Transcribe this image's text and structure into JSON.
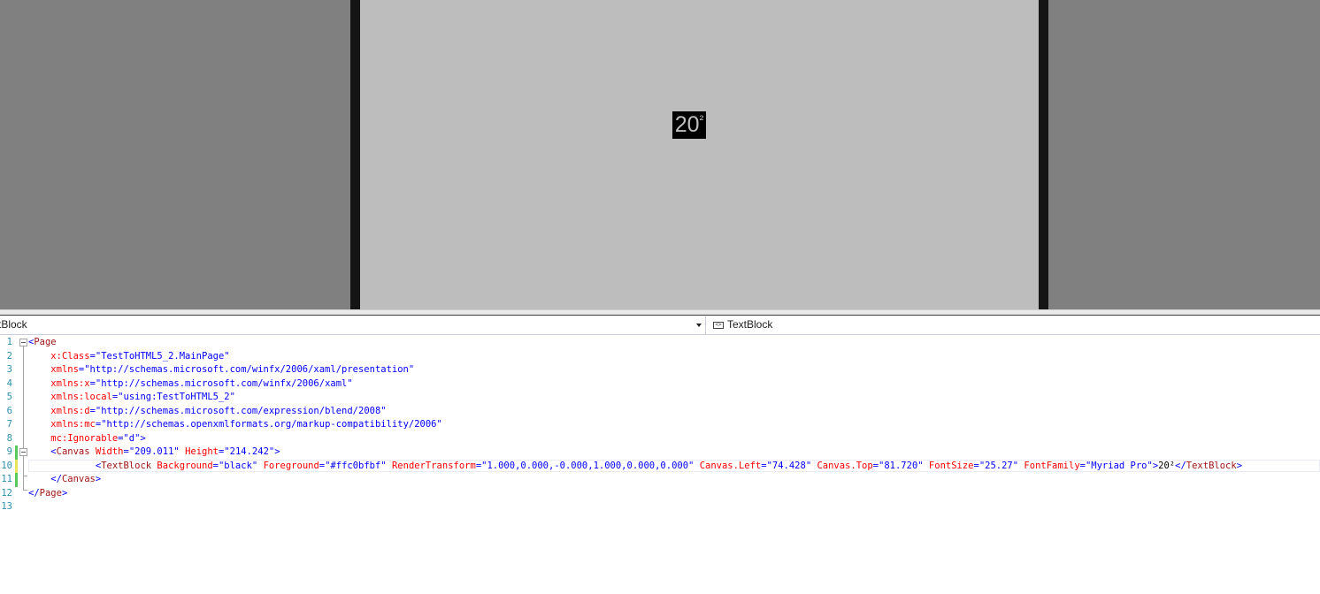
{
  "designer": {
    "textblock": {
      "base": "20",
      "superscript": "²",
      "background_color": "#000000",
      "foreground_color": "#c0bfbf"
    },
    "page_color": "#bdbdbd",
    "frame_color": "#141414",
    "surround_color": "#808080"
  },
  "navbar": {
    "left_label": "xtBlock",
    "right_label": "TextBlock",
    "right_icon": "xaml-element-icon"
  },
  "editor": {
    "colors": {
      "tag": "#a31515",
      "bracket": "#0000ff",
      "attribute": "#ff0000",
      "value": "#0000ff",
      "line_number": "#2b91af"
    },
    "lines": [
      {
        "num": "1",
        "code": "<Page",
        "tokens": [
          {
            "t": "br",
            "v": "<"
          },
          {
            "t": "tag",
            "v": "Page"
          }
        ]
      },
      {
        "num": "2",
        "code": "    x:Class=\"TestToHTML5_2.MainPage\"",
        "tokens": [
          {
            "t": "txt",
            "v": "    "
          },
          {
            "t": "at",
            "v": "x:Class"
          },
          {
            "t": "br",
            "v": "="
          },
          {
            "t": "val",
            "v": "\"TestToHTML5_2.MainPage\""
          }
        ]
      },
      {
        "num": "3",
        "code": "    xmlns=\"http://schemas.microsoft.com/winfx/2006/xaml/presentation\"",
        "tokens": [
          {
            "t": "txt",
            "v": "    "
          },
          {
            "t": "at",
            "v": "xmlns"
          },
          {
            "t": "br",
            "v": "="
          },
          {
            "t": "val",
            "v": "\"http://schemas.microsoft.com/winfx/2006/xaml/presentation\""
          }
        ]
      },
      {
        "num": "4",
        "code": "    xmlns:x=\"http://schemas.microsoft.com/winfx/2006/xaml\"",
        "tokens": [
          {
            "t": "txt",
            "v": "    "
          },
          {
            "t": "at",
            "v": "xmlns:x"
          },
          {
            "t": "br",
            "v": "="
          },
          {
            "t": "val",
            "v": "\"http://schemas.microsoft.com/winfx/2006/xaml\""
          }
        ]
      },
      {
        "num": "5",
        "code": "    xmlns:local=\"using:TestToHTML5_2\"",
        "tokens": [
          {
            "t": "txt",
            "v": "    "
          },
          {
            "t": "at",
            "v": "xmlns:local"
          },
          {
            "t": "br",
            "v": "="
          },
          {
            "t": "val",
            "v": "\"using:TestToHTML5_2\""
          }
        ]
      },
      {
        "num": "6",
        "code": "    xmlns:d=\"http://schemas.microsoft.com/expression/blend/2008\"",
        "tokens": [
          {
            "t": "txt",
            "v": "    "
          },
          {
            "t": "at",
            "v": "xmlns:d"
          },
          {
            "t": "br",
            "v": "="
          },
          {
            "t": "val",
            "v": "\"http://schemas.microsoft.com/expression/blend/2008\""
          }
        ]
      },
      {
        "num": "7",
        "code": "    xmlns:mc=\"http://schemas.openxmlformats.org/markup-compatibility/2006\"",
        "tokens": [
          {
            "t": "txt",
            "v": "    "
          },
          {
            "t": "at",
            "v": "xmlns:mc"
          },
          {
            "t": "br",
            "v": "="
          },
          {
            "t": "val",
            "v": "\"http://schemas.openxmlformats.org/markup-compatibility/2006\""
          }
        ]
      },
      {
        "num": "8",
        "code": "    mc:Ignorable=\"d\">",
        "tokens": [
          {
            "t": "txt",
            "v": "    "
          },
          {
            "t": "at",
            "v": "mc:Ignorable"
          },
          {
            "t": "br",
            "v": "="
          },
          {
            "t": "val",
            "v": "\"d\""
          },
          {
            "t": "br",
            "v": ">"
          }
        ]
      },
      {
        "num": "9",
        "code": "    <Canvas Width=\"209.011\" Height=\"214.242\">",
        "tokens": [
          {
            "t": "txt",
            "v": "    "
          },
          {
            "t": "br",
            "v": "<"
          },
          {
            "t": "tag",
            "v": "Canvas"
          },
          {
            "t": "txt",
            "v": " "
          },
          {
            "t": "at",
            "v": "Width"
          },
          {
            "t": "br",
            "v": "="
          },
          {
            "t": "val",
            "v": "\"209.011\""
          },
          {
            "t": "txt",
            "v": " "
          },
          {
            "t": "at",
            "v": "Height"
          },
          {
            "t": "br",
            "v": "="
          },
          {
            "t": "val",
            "v": "\"214.242\""
          },
          {
            "t": "br",
            "v": ">"
          }
        ]
      },
      {
        "num": "10",
        "code": "            <TextBlock Background=\"black\" Foreground=\"#ffc0bfbf\" RenderTransform=\"1.000,0.000,-0.000,1.000,0.000,0.000\" Canvas.Left=\"74.428\" Canvas.Top=\"81.720\" FontSize=\"25.27\" FontFamily=\"Myriad Pro\">20²</TextBlock>",
        "tokens": [
          {
            "t": "txt",
            "v": "            "
          },
          {
            "t": "br",
            "v": "<"
          },
          {
            "t": "tag",
            "v": "TextBlock"
          },
          {
            "t": "txt",
            "v": " "
          },
          {
            "t": "at",
            "v": "Background"
          },
          {
            "t": "br",
            "v": "="
          },
          {
            "t": "val",
            "v": "\"black\""
          },
          {
            "t": "txt",
            "v": " "
          },
          {
            "t": "at",
            "v": "Foreground"
          },
          {
            "t": "br",
            "v": "="
          },
          {
            "t": "val",
            "v": "\"#ffc0bfbf\""
          },
          {
            "t": "txt",
            "v": " "
          },
          {
            "t": "at",
            "v": "RenderTransform"
          },
          {
            "t": "br",
            "v": "="
          },
          {
            "t": "val",
            "v": "\"1.000,0.000,-0.000,1.000,0.000,0.000\""
          },
          {
            "t": "txt",
            "v": " "
          },
          {
            "t": "at",
            "v": "Canvas.Left"
          },
          {
            "t": "br",
            "v": "="
          },
          {
            "t": "val",
            "v": "\"74.428\""
          },
          {
            "t": "txt",
            "v": " "
          },
          {
            "t": "at",
            "v": "Canvas.Top"
          },
          {
            "t": "br",
            "v": "="
          },
          {
            "t": "val",
            "v": "\"81.720\""
          },
          {
            "t": "txt",
            "v": " "
          },
          {
            "t": "at",
            "v": "FontSize"
          },
          {
            "t": "br",
            "v": "="
          },
          {
            "t": "val",
            "v": "\"25.27\""
          },
          {
            "t": "txt",
            "v": " "
          },
          {
            "t": "at",
            "v": "FontFamily"
          },
          {
            "t": "br",
            "v": "="
          },
          {
            "t": "val",
            "v": "\"Myriad Pro\""
          },
          {
            "t": "br",
            "v": ">"
          },
          {
            "t": "txt",
            "v": "20²"
          },
          {
            "t": "br",
            "v": "</"
          },
          {
            "t": "tag",
            "v": "TextBlock"
          },
          {
            "t": "br",
            "v": ">"
          }
        ]
      },
      {
        "num": "11",
        "code": "    </Canvas>",
        "tokens": [
          {
            "t": "txt",
            "v": "    "
          },
          {
            "t": "br",
            "v": "</"
          },
          {
            "t": "tag",
            "v": "Canvas"
          },
          {
            "t": "br",
            "v": ">"
          }
        ]
      },
      {
        "num": "12",
        "code": "</Page>",
        "tokens": [
          {
            "t": "br",
            "v": "</"
          },
          {
            "t": "tag",
            "v": "Page"
          },
          {
            "t": "br",
            "v": ">"
          }
        ]
      },
      {
        "num": "13",
        "code": "",
        "tokens": []
      }
    ]
  }
}
